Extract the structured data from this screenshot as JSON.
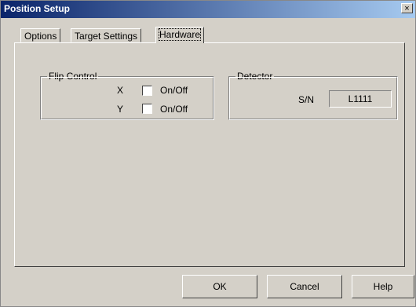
{
  "window": {
    "title": "Position Setup",
    "close_glyph": "×"
  },
  "tabs": [
    {
      "label": "Options",
      "active": false
    },
    {
      "label": "Target Settings",
      "active": false
    },
    {
      "label": "Hardware",
      "active": true
    }
  ],
  "flip_control": {
    "title": "Flip Control",
    "x_label": "X",
    "y_label": "Y",
    "x_option": "On/Off",
    "y_option": "On/Off",
    "x_checked": false,
    "y_checked": false
  },
  "detector": {
    "title": "Detector",
    "sn_label": "S/N",
    "sn_value": "L1111"
  },
  "buttons": {
    "ok": "OK",
    "cancel": "Cancel",
    "help": "Help"
  }
}
